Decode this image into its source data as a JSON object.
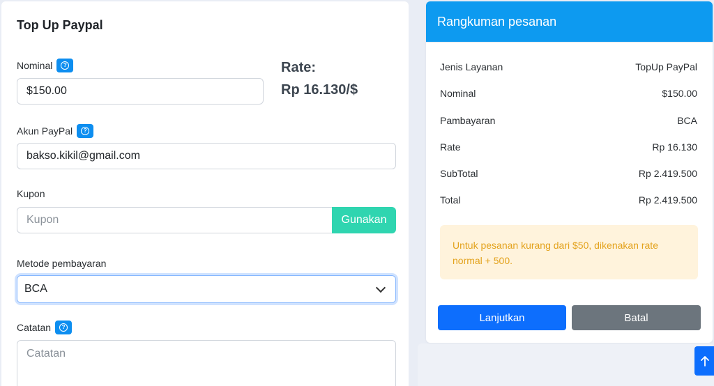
{
  "form": {
    "title": "Top Up Paypal",
    "nominal_label": "Nominal",
    "nominal_value": "$150.00",
    "rate_label": "Rate:",
    "rate_value": "Rp 16.130/$",
    "paypal_label": "Akun PayPal",
    "paypal_value": "bakso.kikil@gmail.com",
    "coupon_label": "Kupon",
    "coupon_placeholder": "Kupon",
    "coupon_button": "Gunakan",
    "payment_label": "Metode pembayaran",
    "payment_selected": "BCA",
    "notes_label": "Catatan",
    "notes_placeholder": "Catatan"
  },
  "summary": {
    "title": "Rangkuman pesanan",
    "rows": [
      {
        "label": "Jenis Layanan",
        "value": "TopUp PayPal"
      },
      {
        "label": "Nominal",
        "value": "$150.00"
      },
      {
        "label": "Pambayaran",
        "value": "BCA"
      },
      {
        "label": "Rate",
        "value": "Rp 16.130"
      },
      {
        "label": "SubTotal",
        "value": "Rp 2.419.500"
      },
      {
        "label": "Total",
        "value": "Rp 2.419.500"
      }
    ],
    "alert": "Untuk pesanan kurang dari $50, dikenakan rate normal + 500.",
    "continue_button": "Lanjutkan",
    "cancel_button": "Batal"
  },
  "colors": {
    "accent": "#0d9af0",
    "primary": "#0d6efd",
    "secondary": "#6c757d",
    "success": "#2fd5b0",
    "warning_text": "#e3a21c",
    "warning_bg": "#fff3dc"
  }
}
